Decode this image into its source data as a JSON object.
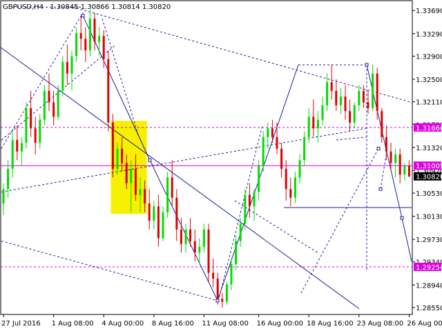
{
  "header": {
    "symbol": "GBPUSD,H4",
    "ohlc": "1.30845 1.30866 1.30814 1.30820"
  },
  "colors": {
    "bull": "#00dd00",
    "bear": "#dd0000",
    "doji": "#000000",
    "trend": "#1a1aa0",
    "level": "#e000e0",
    "zone": "#f7f000",
    "axis": "#000000",
    "current_badge_bg": "#000000",
    "current_badge_fg": "#ffffff",
    "level_badge_fg": "#ffffff"
  },
  "chart_data": {
    "type": "candlestick",
    "title": "GBPUSD,H4",
    "y_axis_side": "right",
    "ylim": [
      1.2843,
      1.3386
    ],
    "y_ticks": [
      "1.33690",
      "1.33290",
      "1.32900",
      "1.32500",
      "1.32110",
      "1.31720",
      "1.31320",
      "1.30920",
      "1.30530",
      "1.30130",
      "1.29730",
      "1.29340",
      "1.28940",
      "1.28550"
    ],
    "x_ticks": [
      "27 Jul 2016",
      "1 Aug 08:00",
      "4 Aug 00:00",
      "8 Aug 16:00",
      "11 Aug 08:00",
      "16 Aug 00:00",
      "18 Aug 16:00",
      "23 Aug 08:00",
      "26 Aug 00:00"
    ],
    "x_tick_index": [
      0,
      11,
      22,
      33,
      44,
      56,
      67,
      78,
      89
    ],
    "current_price": "1.30820",
    "levels": [
      {
        "label": "1.31666",
        "value": 1.31666
      },
      {
        "label": "1.31005",
        "value": 1.31005
      },
      {
        "label": "1.29254",
        "value": 1.29254
      }
    ],
    "zone": {
      "x_from_bar": 24,
      "x_to_bar": 31,
      "y_high": 1.3178,
      "y_low": 1.3017
    },
    "candles": [
      [
        1.3035,
        1.307,
        1.3015,
        1.306
      ],
      [
        1.306,
        1.311,
        1.3045,
        1.3095
      ],
      [
        1.3095,
        1.316,
        1.308,
        1.3145
      ],
      [
        1.3145,
        1.317,
        1.311,
        1.3125
      ],
      [
        1.3125,
        1.315,
        1.31,
        1.314
      ],
      [
        1.314,
        1.321,
        1.313,
        1.32
      ],
      [
        1.32,
        1.323,
        1.315,
        1.3165
      ],
      [
        1.3165,
        1.3185,
        1.312,
        1.314
      ],
      [
        1.314,
        1.319,
        1.313,
        1.318
      ],
      [
        1.318,
        1.324,
        1.317,
        1.323
      ],
      [
        1.323,
        1.326,
        1.3195,
        1.321
      ],
      [
        1.321,
        1.323,
        1.317,
        1.3185
      ],
      [
        1.3185,
        1.324,
        1.318,
        1.323
      ],
      [
        1.323,
        1.329,
        1.322,
        1.328
      ],
      [
        1.328,
        1.331,
        1.324,
        1.326
      ],
      [
        1.326,
        1.33,
        1.323,
        1.329
      ],
      [
        1.329,
        1.334,
        1.328,
        1.333
      ],
      [
        1.333,
        1.336,
        1.33,
        1.332
      ],
      [
        1.332,
        1.334,
        1.328,
        1.33
      ],
      [
        1.33,
        1.337,
        1.329,
        1.3355
      ],
      [
        1.3355,
        1.3365,
        1.33,
        1.3315
      ],
      [
        1.3315,
        1.334,
        1.329,
        1.3325
      ],
      [
        1.3325,
        1.3335,
        1.327,
        1.3285
      ],
      [
        1.3285,
        1.33,
        1.316,
        1.3175
      ],
      [
        1.3175,
        1.319,
        1.308,
        1.3095
      ],
      [
        1.3095,
        1.314,
        1.3085,
        1.313
      ],
      [
        1.313,
        1.315,
        1.309,
        1.3105
      ],
      [
        1.3105,
        1.312,
        1.306,
        1.307
      ],
      [
        1.307,
        1.311,
        1.302,
        1.3095
      ],
      [
        1.3095,
        1.312,
        1.304,
        1.305
      ],
      [
        1.305,
        1.308,
        1.302,
        1.306
      ],
      [
        1.306,
        1.3075,
        1.302,
        1.3035
      ],
      [
        1.3035,
        1.306,
        1.299,
        1.3005
      ],
      [
        1.3005,
        1.304,
        1.299,
        1.303
      ],
      [
        1.303,
        1.305,
        1.296,
        1.2975
      ],
      [
        1.2975,
        1.303,
        1.297,
        1.302
      ],
      [
        1.302,
        1.309,
        1.301,
        1.308
      ],
      [
        1.308,
        1.311,
        1.303,
        1.3045
      ],
      [
        1.3045,
        1.306,
        1.297,
        1.299
      ],
      [
        1.299,
        1.301,
        1.295,
        1.2965
      ],
      [
        1.2965,
        1.3,
        1.295,
        1.299
      ],
      [
        1.299,
        1.301,
        1.296,
        1.297
      ],
      [
        1.297,
        1.299,
        1.2935,
        1.295
      ],
      [
        1.295,
        1.2975,
        1.293,
        1.296
      ],
      [
        1.296,
        1.3,
        1.295,
        1.299
      ],
      [
        1.299,
        1.3,
        1.29,
        1.2915
      ],
      [
        1.2915,
        1.294,
        1.289,
        1.2905
      ],
      [
        1.2905,
        1.2915,
        1.286,
        1.287
      ],
      [
        1.287,
        1.288,
        1.2855,
        1.2865
      ],
      [
        1.2865,
        1.29,
        1.286,
        1.2895
      ],
      [
        1.2895,
        1.294,
        1.2885,
        1.293
      ],
      [
        1.293,
        1.298,
        1.292,
        1.297
      ],
      [
        1.297,
        1.301,
        1.296,
        1.3
      ],
      [
        1.3,
        1.306,
        1.299,
        1.305
      ],
      [
        1.305,
        1.307,
        1.301,
        1.303
      ],
      [
        1.303,
        1.306,
        1.3005,
        1.3055
      ],
      [
        1.3055,
        1.311,
        1.304,
        1.31
      ],
      [
        1.31,
        1.316,
        1.309,
        1.315
      ],
      [
        1.315,
        1.3175,
        1.313,
        1.3165
      ],
      [
        1.3165,
        1.318,
        1.314,
        1.315
      ],
      [
        1.315,
        1.3175,
        1.312,
        1.313
      ],
      [
        1.313,
        1.314,
        1.308,
        1.3095
      ],
      [
        1.3095,
        1.311,
        1.304,
        1.306
      ],
      [
        1.306,
        1.308,
        1.303,
        1.3045
      ],
      [
        1.3045,
        1.309,
        1.3035,
        1.308
      ],
      [
        1.308,
        1.312,
        1.307,
        1.311
      ],
      [
        1.311,
        1.316,
        1.31,
        1.315
      ],
      [
        1.315,
        1.32,
        1.314,
        1.3185
      ],
      [
        1.3185,
        1.3215,
        1.315,
        1.3165
      ],
      [
        1.3165,
        1.3195,
        1.314,
        1.318
      ],
      [
        1.318,
        1.322,
        1.317,
        1.3205
      ],
      [
        1.3205,
        1.326,
        1.3195,
        1.3245
      ],
      [
        1.3245,
        1.3275,
        1.3215,
        1.323
      ],
      [
        1.323,
        1.325,
        1.3195,
        1.3205
      ],
      [
        1.3205,
        1.3235,
        1.319,
        1.322
      ],
      [
        1.322,
        1.324,
        1.318,
        1.3195
      ],
      [
        1.3195,
        1.3215,
        1.316,
        1.3175
      ],
      [
        1.3175,
        1.321,
        1.3165,
        1.3205
      ],
      [
        1.3205,
        1.324,
        1.3195,
        1.323
      ],
      [
        1.323,
        1.324,
        1.32,
        1.321
      ],
      [
        1.321,
        1.323,
        1.319,
        1.32
      ],
      [
        1.32,
        1.3275,
        1.3195,
        1.326
      ],
      [
        1.326,
        1.327,
        1.318,
        1.3195
      ],
      [
        1.3195,
        1.32,
        1.314,
        1.315
      ],
      [
        1.315,
        1.317,
        1.311,
        1.3125
      ],
      [
        1.3125,
        1.314,
        1.309,
        1.3105
      ],
      [
        1.3105,
        1.313,
        1.308,
        1.312
      ],
      [
        1.312,
        1.313,
        1.307,
        1.3085
      ],
      [
        1.3085,
        1.3105,
        1.3075,
        1.31
      ],
      [
        1.31,
        1.311,
        1.308,
        1.3082
      ]
    ],
    "trend_lines": [
      {
        "x1": 1,
        "y1": 1.3305,
        "x2": 520,
        "y2": 1.2853,
        "style": "solid"
      },
      {
        "x1": 2,
        "y1": 1.3145,
        "x2": 168,
        "y2": 1.331,
        "style": "dashed"
      },
      {
        "x1": 2,
        "y1": 1.313,
        "x2": 120,
        "y2": 1.3365,
        "style": "dashed"
      },
      {
        "x1": 2,
        "y1": 1.3055,
        "x2": 530,
        "y2": 1.3165,
        "style": "dashed"
      },
      {
        "x1": 2,
        "y1": 1.297,
        "x2": 315,
        "y2": 1.2867,
        "style": "dashed"
      },
      {
        "x1": 105,
        "y1": 1.3375,
        "x2": 596,
        "y2": 1.321,
        "style": "dashed"
      },
      {
        "x1": 18,
        "y1": 1.3375,
        "x2": 120,
        "y2": 1.3375,
        "style": "dashed"
      },
      {
        "x1": 148,
        "y1": 1.3355,
        "x2": 200,
        "y2": 1.3155,
        "style": "dashed"
      },
      {
        "x1": 120,
        "y1": 1.336,
        "x2": 217,
        "y2": 1.311,
        "style": "solid"
      },
      {
        "x1": 217,
        "y1": 1.311,
        "x2": 315,
        "y2": 1.2867,
        "style": "solid"
      },
      {
        "x1": 315,
        "y1": 1.2867,
        "x2": 432,
        "y2": 1.3275,
        "style": "solid"
      },
      {
        "x1": 432,
        "y1": 1.3275,
        "x2": 531,
        "y2": 1.3275,
        "style": "dashed"
      },
      {
        "x1": 531,
        "y1": 1.3275,
        "x2": 582,
        "y2": 1.301,
        "style": "solid"
      },
      {
        "x1": 582,
        "y1": 1.301,
        "x2": 596,
        "y2": 1.2935,
        "style": "solid"
      },
      {
        "x1": 411,
        "y1": 1.3028,
        "x2": 596,
        "y2": 1.3028,
        "style": "solid"
      },
      {
        "x1": 531,
        "y1": 1.3275,
        "x2": 531,
        "y2": 1.292,
        "style": "dashed"
      },
      {
        "x1": 436,
        "y1": 1.288,
        "x2": 548,
        "y2": 1.313,
        "style": "dashed"
      },
      {
        "x1": 487,
        "y1": 1.3145,
        "x2": 531,
        "y2": 1.315,
        "style": "dashed"
      },
      {
        "x1": 551,
        "y1": 1.306,
        "x2": 560,
        "y2": 1.3125,
        "style": "dashed"
      },
      {
        "x1": 316,
        "y1": 1.2866,
        "x2": 380,
        "y2": 1.317,
        "style": "dashed"
      },
      {
        "x1": 340,
        "y1": 1.304,
        "x2": 460,
        "y2": 1.295,
        "style": "dashed"
      }
    ]
  }
}
